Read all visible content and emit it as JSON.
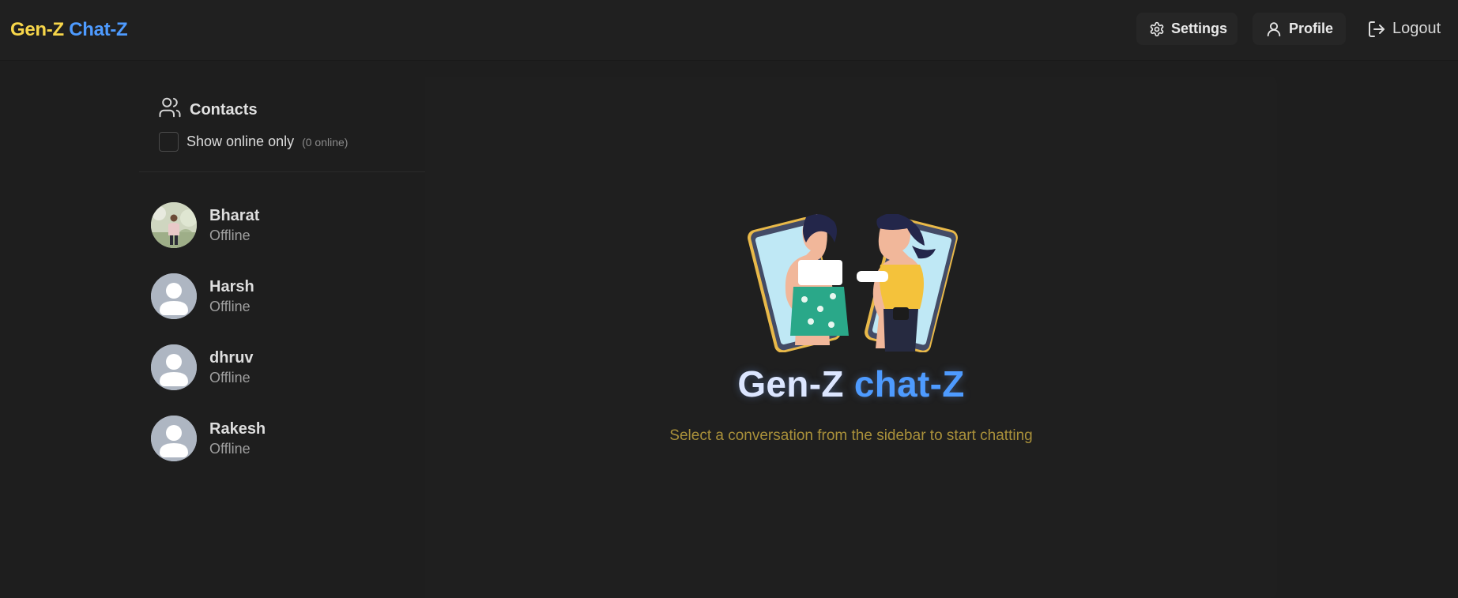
{
  "brand": {
    "part1": "Gen-Z",
    "part2": "Chat-Z",
    "color1": "#f7d64a",
    "color2": "#4e9bff"
  },
  "header": {
    "settings_label": "Settings",
    "profile_label": "Profile",
    "logout_label": "Logout",
    "icons": {
      "settings": "gear-icon",
      "profile": "user-icon",
      "logout": "logout-icon"
    }
  },
  "sidebar": {
    "title": "Contacts",
    "filter_label": "Show online only",
    "online_count": "(0 online)",
    "filter_checked": false,
    "contacts": [
      {
        "name": "Bharat",
        "status": "Offline",
        "avatar": "photo"
      },
      {
        "name": "Harsh",
        "status": "Offline",
        "avatar": "default-user-icon"
      },
      {
        "name": "dhruv",
        "status": "Offline",
        "avatar": "default-user-icon"
      },
      {
        "name": "Rakesh",
        "status": "Offline",
        "avatar": "default-user-icon"
      }
    ]
  },
  "welcome": {
    "title_part1": "Gen-Z",
    "title_part2": "chat-Z",
    "subtitle": "Select a conversation from the sidebar to start chatting",
    "illustration": "two-friends-phones-illustration",
    "accent": "#4e9bff",
    "subtitle_color": "#a9903a"
  }
}
